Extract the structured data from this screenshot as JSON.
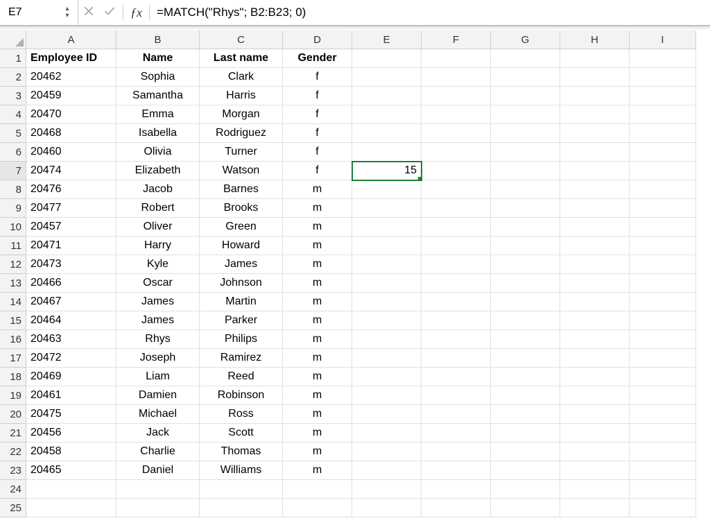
{
  "name_box": "E7",
  "formula": "=MATCH(\"Rhys\"; B2:B23; 0)",
  "columns": [
    "A",
    "B",
    "C",
    "D",
    "E",
    "F",
    "G",
    "H",
    "I"
  ],
  "row_count": 25,
  "active": {
    "row": 7,
    "col": "E"
  },
  "headers": {
    "A": "Employee ID",
    "B": "Name",
    "C": "Last name",
    "D": "Gender"
  },
  "data_rows": [
    {
      "A": "20462",
      "B": "Sophia",
      "C": "Clark",
      "D": "f"
    },
    {
      "A": "20459",
      "B": "Samantha",
      "C": "Harris",
      "D": "f"
    },
    {
      "A": "20470",
      "B": "Emma",
      "C": "Morgan",
      "D": "f"
    },
    {
      "A": "20468",
      "B": "Isabella",
      "C": "Rodriguez",
      "D": "f"
    },
    {
      "A": "20460",
      "B": "Olivia",
      "C": "Turner",
      "D": "f"
    },
    {
      "A": "20474",
      "B": "Elizabeth",
      "C": "Watson",
      "D": "f"
    },
    {
      "A": "20476",
      "B": "Jacob",
      "C": "Barnes",
      "D": "m"
    },
    {
      "A": "20477",
      "B": "Robert",
      "C": "Brooks",
      "D": "m"
    },
    {
      "A": "20457",
      "B": "Oliver",
      "C": "Green",
      "D": "m"
    },
    {
      "A": "20471",
      "B": "Harry",
      "C": "Howard",
      "D": "m"
    },
    {
      "A": "20473",
      "B": "Kyle",
      "C": "James",
      "D": "m"
    },
    {
      "A": "20466",
      "B": "Oscar",
      "C": "Johnson",
      "D": "m"
    },
    {
      "A": "20467",
      "B": "James",
      "C": "Martin",
      "D": "m"
    },
    {
      "A": "20464",
      "B": "James",
      "C": "Parker",
      "D": "m"
    },
    {
      "A": "20463",
      "B": "Rhys",
      "C": "Philips",
      "D": "m"
    },
    {
      "A": "20472",
      "B": "Joseph",
      "C": "Ramirez",
      "D": "m"
    },
    {
      "A": "20469",
      "B": "Liam",
      "C": "Reed",
      "D": "m"
    },
    {
      "A": "20461",
      "B": "Damien",
      "C": "Robinson",
      "D": "m"
    },
    {
      "A": "20475",
      "B": "Michael",
      "C": "Ross",
      "D": "m"
    },
    {
      "A": "20456",
      "B": "Jack",
      "C": "Scott",
      "D": "m"
    },
    {
      "A": "20458",
      "B": "Charlie",
      "C": "Thomas",
      "D": "m"
    },
    {
      "A": "20465",
      "B": "Daniel",
      "C": "Williams",
      "D": "m"
    }
  ],
  "extra_cells": {
    "E7": "15"
  },
  "align": {
    "A": "left",
    "B": "center",
    "C": "center",
    "D": "center",
    "E": "right",
    "F": "left",
    "G": "left",
    "H": "left",
    "I": "left"
  },
  "chart_data": {
    "type": "table",
    "title": "",
    "columns": [
      "Employee ID",
      "Name",
      "Last name",
      "Gender"
    ],
    "rows": [
      [
        "20462",
        "Sophia",
        "Clark",
        "f"
      ],
      [
        "20459",
        "Samantha",
        "Harris",
        "f"
      ],
      [
        "20470",
        "Emma",
        "Morgan",
        "f"
      ],
      [
        "20468",
        "Isabella",
        "Rodriguez",
        "f"
      ],
      [
        "20460",
        "Olivia",
        "Turner",
        "f"
      ],
      [
        "20474",
        "Elizabeth",
        "Watson",
        "f"
      ],
      [
        "20476",
        "Jacob",
        "Barnes",
        "m"
      ],
      [
        "20477",
        "Robert",
        "Brooks",
        "m"
      ],
      [
        "20457",
        "Oliver",
        "Green",
        "m"
      ],
      [
        "20471",
        "Harry",
        "Howard",
        "m"
      ],
      [
        "20473",
        "Kyle",
        "James",
        "m"
      ],
      [
        "20466",
        "Oscar",
        "Johnson",
        "m"
      ],
      [
        "20467",
        "James",
        "Martin",
        "m"
      ],
      [
        "20464",
        "James",
        "Parker",
        "m"
      ],
      [
        "20463",
        "Rhys",
        "Philips",
        "m"
      ],
      [
        "20472",
        "Joseph",
        "Ramirez",
        "m"
      ],
      [
        "20469",
        "Liam",
        "Reed",
        "m"
      ],
      [
        "20461",
        "Damien",
        "Robinson",
        "m"
      ],
      [
        "20475",
        "Michael",
        "Ross",
        "m"
      ],
      [
        "20456",
        "Jack",
        "Scott",
        "m"
      ],
      [
        "20458",
        "Charlie",
        "Thomas",
        "m"
      ],
      [
        "20465",
        "Daniel",
        "Williams",
        "m"
      ]
    ]
  }
}
